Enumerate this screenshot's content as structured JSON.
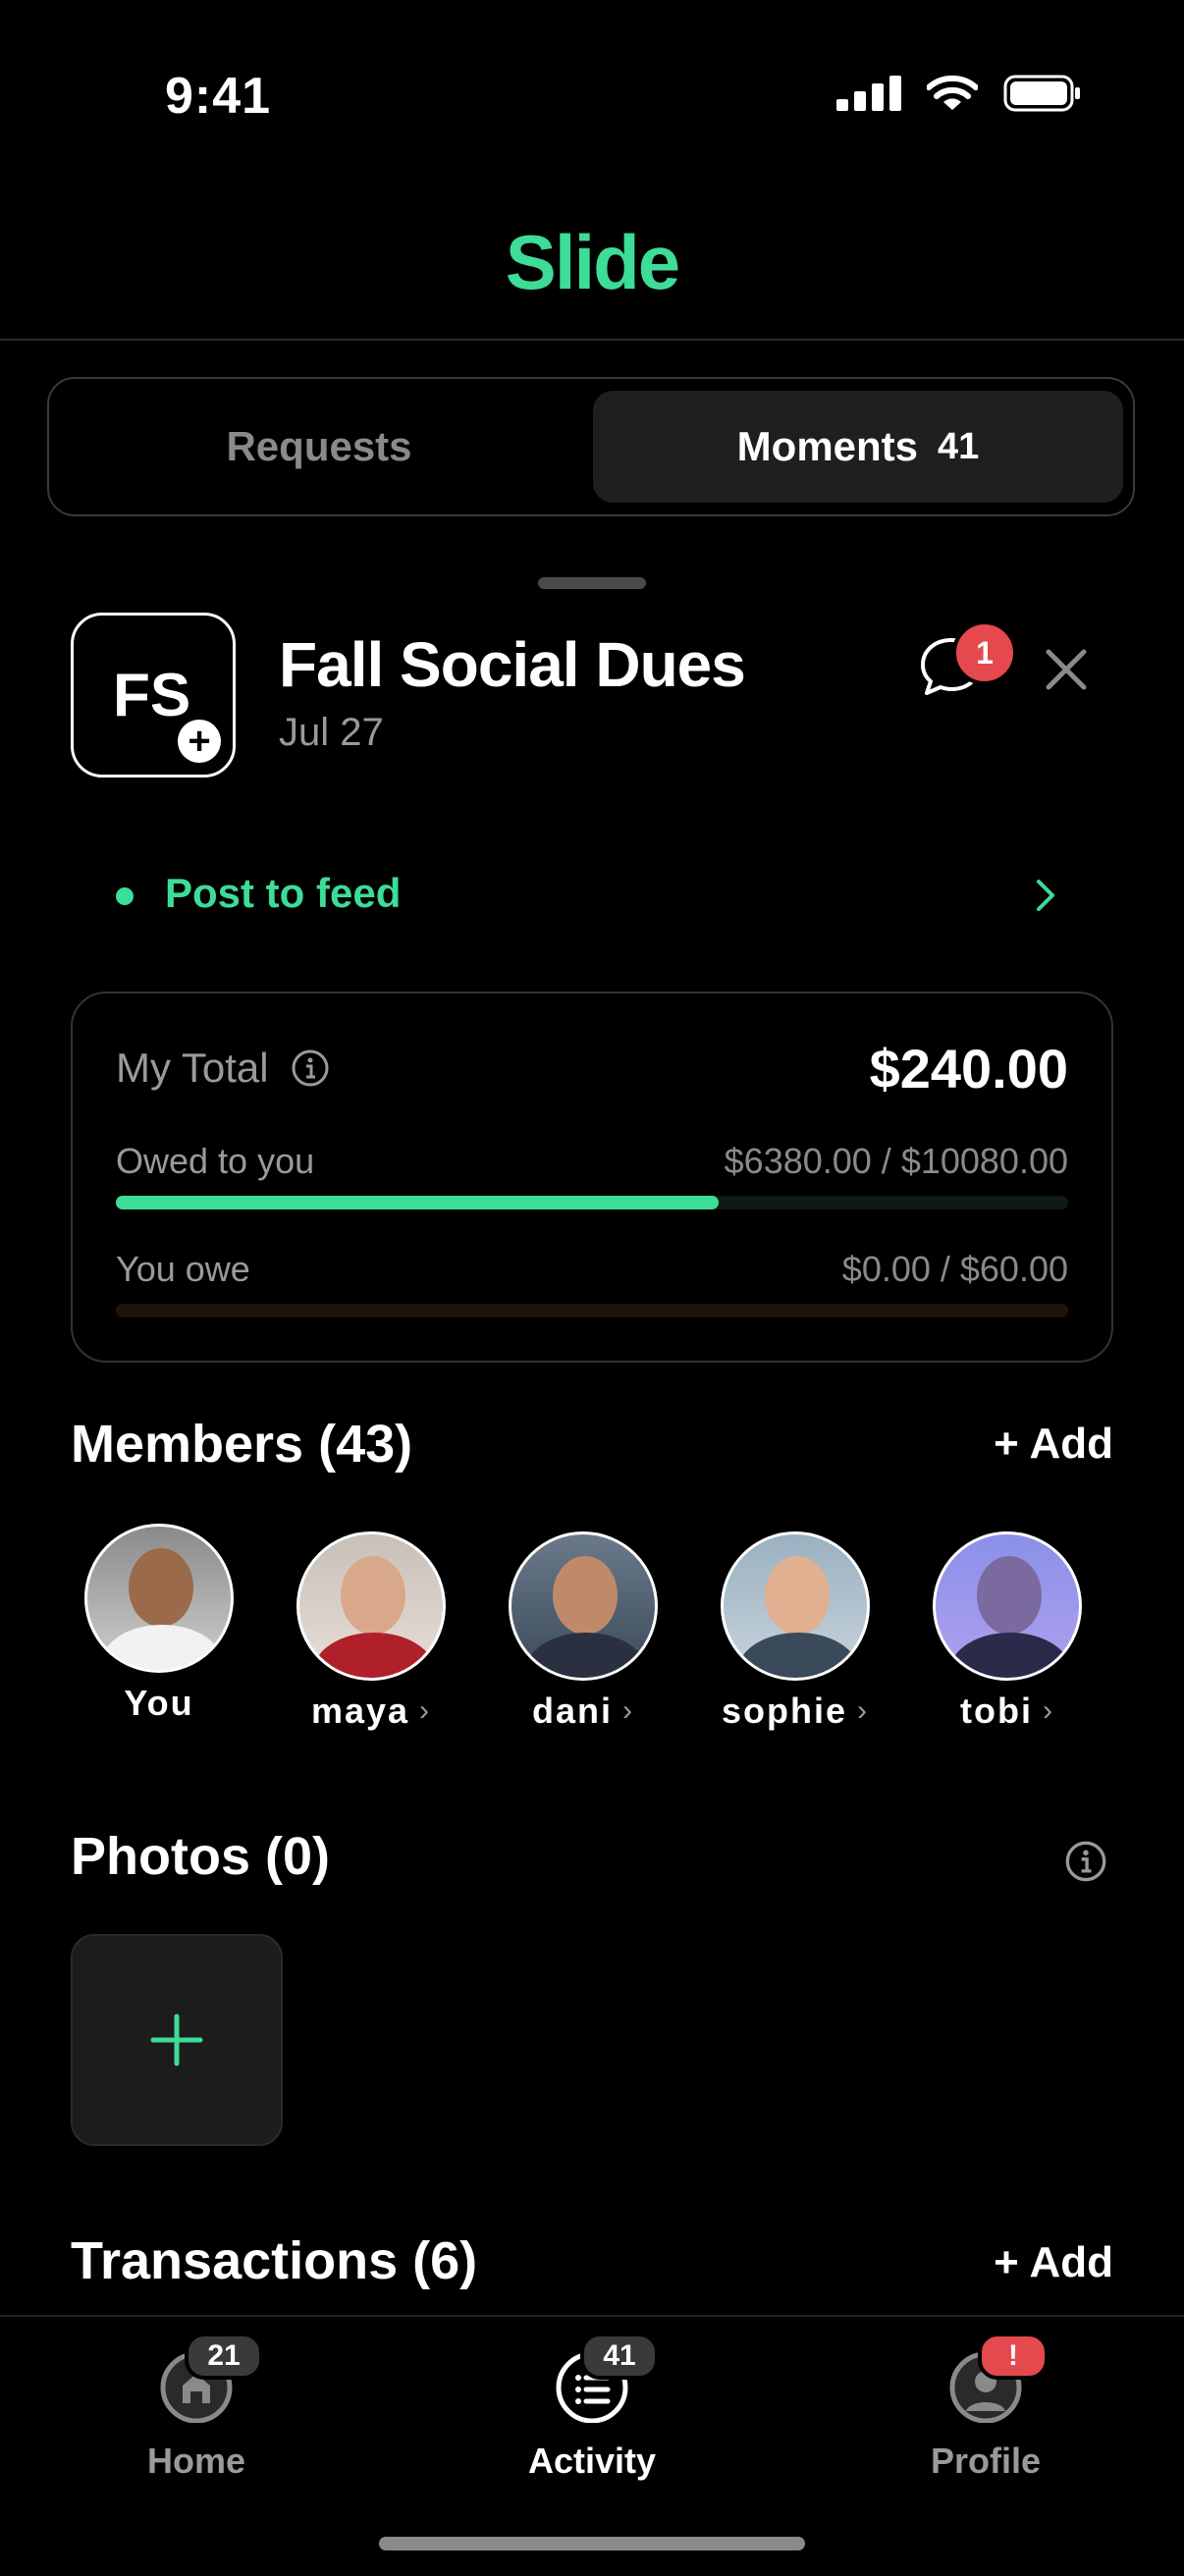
{
  "status_bar": {
    "time": "9:41"
  },
  "app": {
    "logo": "Slide",
    "accent_color": "#3ddc97"
  },
  "segmented_control": {
    "tabs": [
      {
        "label": "Requests",
        "selected": false
      },
      {
        "label": "Moments",
        "count": "41",
        "selected": true
      }
    ]
  },
  "moment": {
    "initials": "FS",
    "title": "Fall Social Dues",
    "date": "Jul 27",
    "chat_badge": "1",
    "post_to_feed": "Post to feed"
  },
  "totals": {
    "my_total_label": "My Total",
    "my_total_value": "$240.00",
    "owed_to_you_label": "Owed to you",
    "owed_to_you_value": "$6380.00 / $10080.00",
    "owed_progress_fraction": 0.633,
    "you_owe_label": "You owe",
    "you_owe_value": "$0.00 / $60.00",
    "you_owe_progress_fraction": 0.0
  },
  "members": {
    "title": "Members (43)",
    "add_label": "+ Add",
    "list": [
      {
        "name": "You",
        "has_chevron": false
      },
      {
        "name": "maya",
        "has_chevron": true
      },
      {
        "name": "dani",
        "has_chevron": true
      },
      {
        "name": "sophie",
        "has_chevron": true
      },
      {
        "name": "tobi",
        "has_chevron": true
      }
    ],
    "chevron": "›"
  },
  "photos": {
    "title": "Photos (0)"
  },
  "transactions": {
    "title": "Transactions (6)",
    "add_label": "+ Add"
  },
  "tab_bar": {
    "tabs": [
      {
        "label": "Home",
        "badge": "21",
        "icon": "home-icon",
        "active": false
      },
      {
        "label": "Activity",
        "badge": "41",
        "icon": "activity-list-icon",
        "active": true
      },
      {
        "label": "Profile",
        "badge": "!",
        "icon": "profile-icon",
        "active": false
      }
    ]
  }
}
